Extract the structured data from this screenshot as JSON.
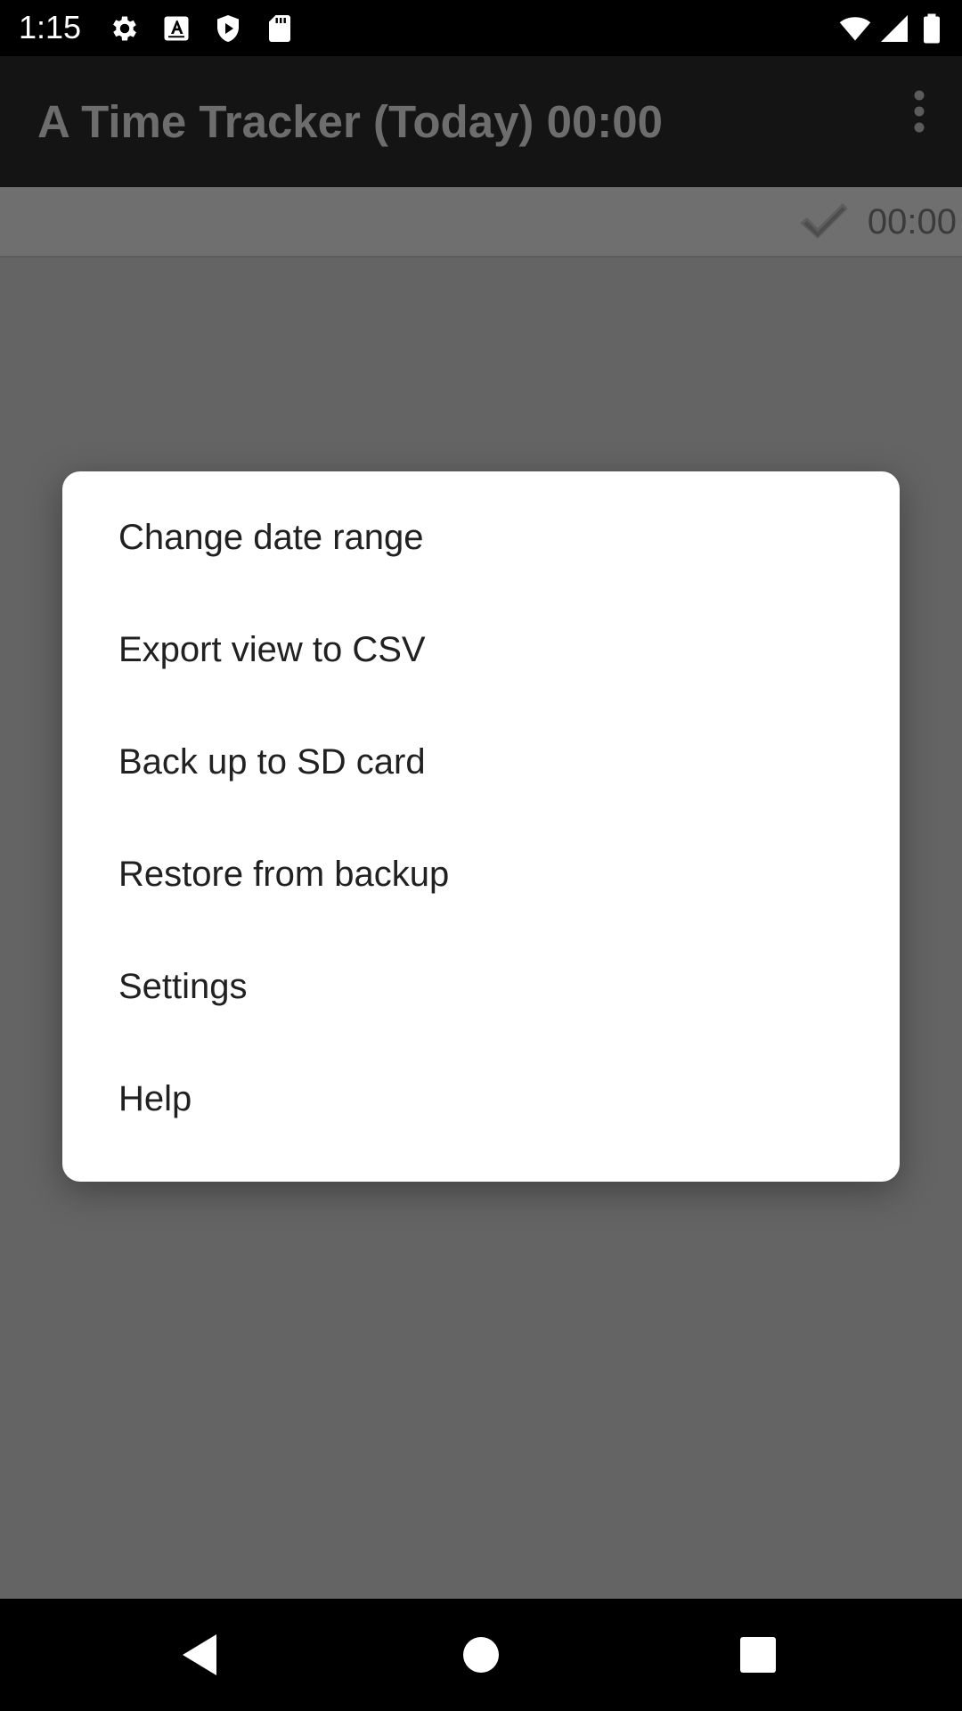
{
  "status_bar": {
    "time": "1:15",
    "left_icons": [
      "gear-icon",
      "keyboard-a-icon",
      "shield-play-icon",
      "sd-card-icon"
    ],
    "right_icons": [
      "wifi-icon",
      "signal-icon",
      "battery-icon"
    ]
  },
  "app_bar": {
    "title": "A Time Tracker (Today) 00:00",
    "menu_icon": "more-vertical-icon"
  },
  "summary": {
    "check_icon": "checkmark-icon",
    "total": "00:00"
  },
  "dialog": {
    "items": [
      {
        "label": "Change date range"
      },
      {
        "label": "Export view to CSV"
      },
      {
        "label": "Back up to SD card"
      },
      {
        "label": "Restore from backup"
      },
      {
        "label": "Settings"
      },
      {
        "label": "Help"
      }
    ]
  },
  "nav_bar": {
    "buttons": [
      "back-icon",
      "home-icon",
      "recents-icon"
    ]
  },
  "colors": {
    "scrim": "#646464",
    "dialog_bg": "#ffffff",
    "menu_text": "#212121",
    "system_bars": "#000000"
  }
}
